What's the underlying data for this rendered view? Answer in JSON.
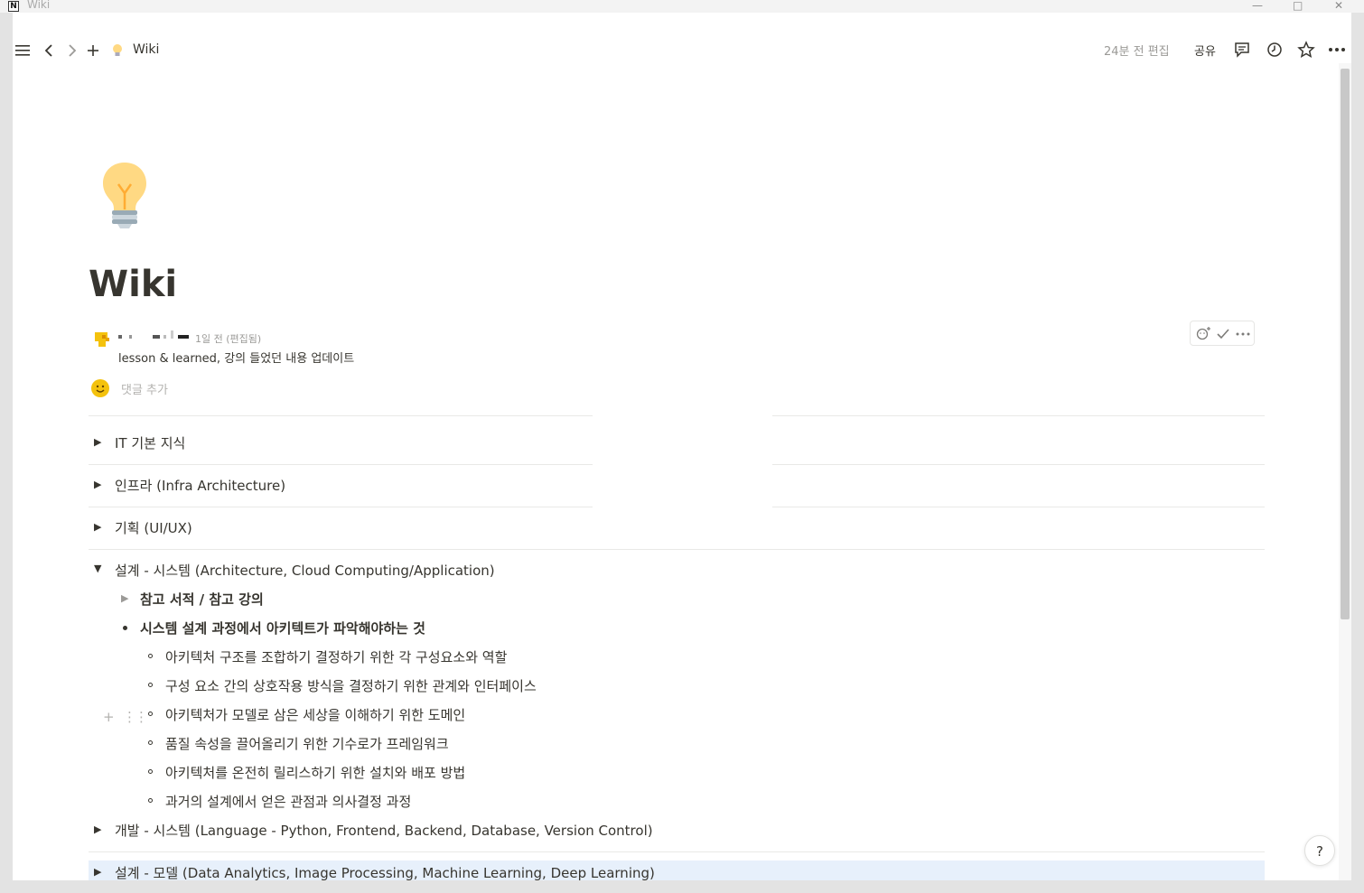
{
  "os": {
    "window_title": "Wiki"
  },
  "topbar": {
    "breadcrumb_title": "Wiki",
    "edited": "24분 전 편집",
    "share": "공유"
  },
  "page": {
    "title": "Wiki",
    "icon": "lightbulb-icon"
  },
  "comment": {
    "time": "1일 전 (편집됨)",
    "body": "lesson & learned, 강의 들었던 내용 업데이트",
    "add_placeholder": "댓글 추가"
  },
  "toggles": [
    {
      "label": "IT 기본 지식",
      "expanded": false
    },
    {
      "label": "인프라 (Infra Architecture)",
      "expanded": false
    },
    {
      "label": "기획 (UI/UX)",
      "expanded": false
    },
    {
      "label": "설계 - 시스템 (Architecture, Cloud Computing/Application)",
      "expanded": true
    },
    {
      "label": "개발 - 시스템 (Language - Python, Frontend, Backend, Database, Version Control)",
      "expanded": false
    },
    {
      "label": "설계 - 모델 (Data Analytics, Image Processing, Machine Learning, Deep Learning)",
      "expanded": false
    }
  ],
  "expanded_section": {
    "sub_toggle": "참고 서적 / 참고 강의",
    "bullet": "시스템 설계 과정에서 아키텍트가 파악해야하는 것",
    "sub_bullets": [
      "아키텍처 구조를 조합하기 결정하기 위한 각 구성요소와 역할",
      "구성 요소 간의 상호작용 방식을 결정하기 위한 관계와 인터페이스",
      "아키텍처가 모델로 삼은 세상을 이해하기 위한 도메인",
      "품질 속성을 끌어올리기 위한 기수로가 프레임워크",
      "아키텍처를 온전히 릴리스하기 위한 설치와 배포 방법",
      "과거의 설계에서 얻은 관점과 의사결정 과정"
    ]
  },
  "help": "?"
}
